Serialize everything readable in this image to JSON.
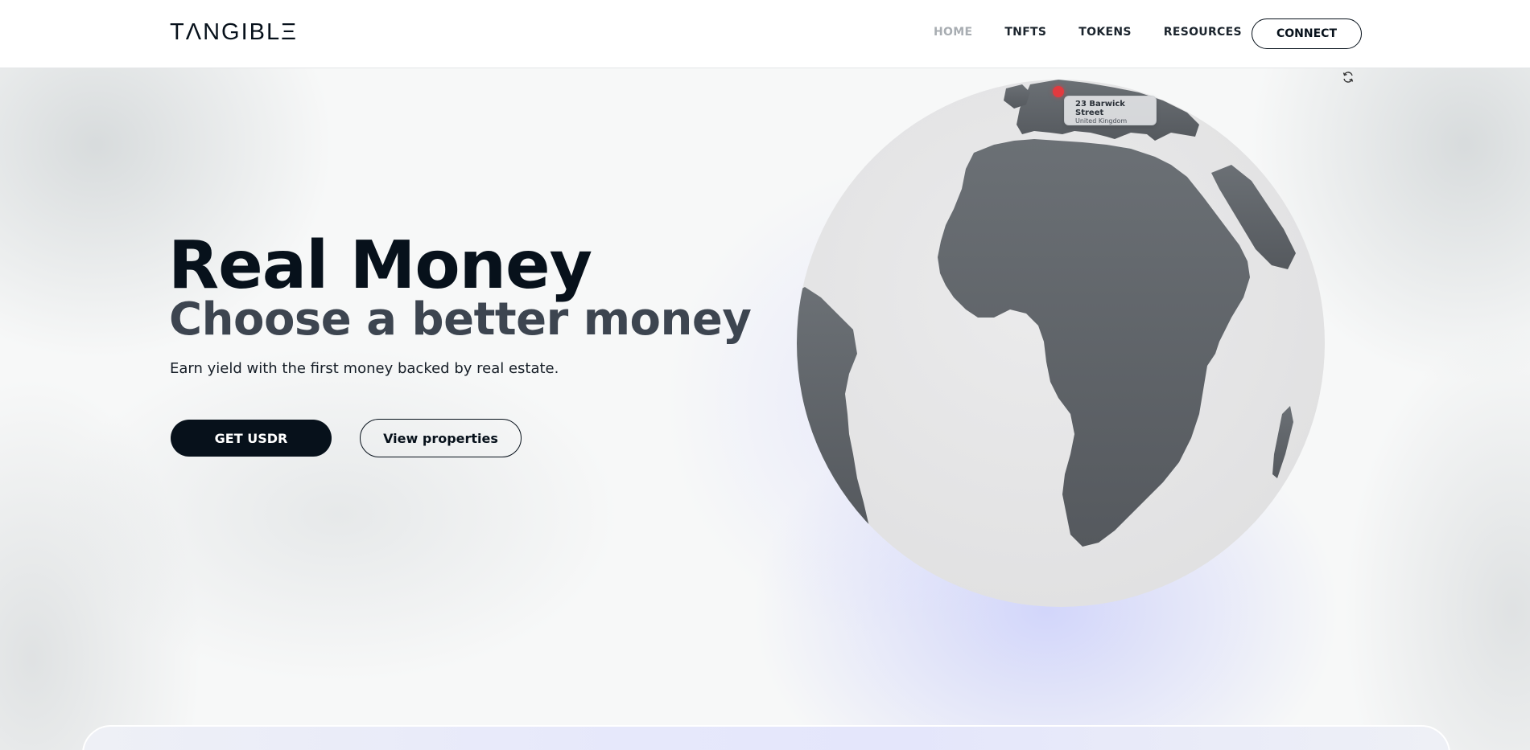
{
  "brand": {
    "logo_text": "TΛNGIBLΞ"
  },
  "nav": {
    "items": [
      {
        "label": "HOME",
        "active": true
      },
      {
        "label": "TNFTS",
        "active": false
      },
      {
        "label": "TOKENS",
        "active": false
      },
      {
        "label": "RESOURCES",
        "active": false
      }
    ],
    "connect_label": "CONNECT"
  },
  "hero": {
    "title": "Real Money",
    "subtitle": "Choose a better money",
    "description": "Earn yield with the first money backed by real estate.",
    "primary_button": "GET USDR",
    "secondary_button": "View properties"
  },
  "globe": {
    "refresh_icon": "refresh-icon",
    "location": {
      "title": "23 Barwick Street",
      "subtitle": "United Kingdom"
    },
    "marker_color": "#e23a3f",
    "land_color": "#5c6166",
    "sphere_color": "#e8e8e9"
  },
  "colors": {
    "primary": "#07111b",
    "nav_active": "#a8adb2",
    "accent_glow": "#dfe2fb"
  }
}
